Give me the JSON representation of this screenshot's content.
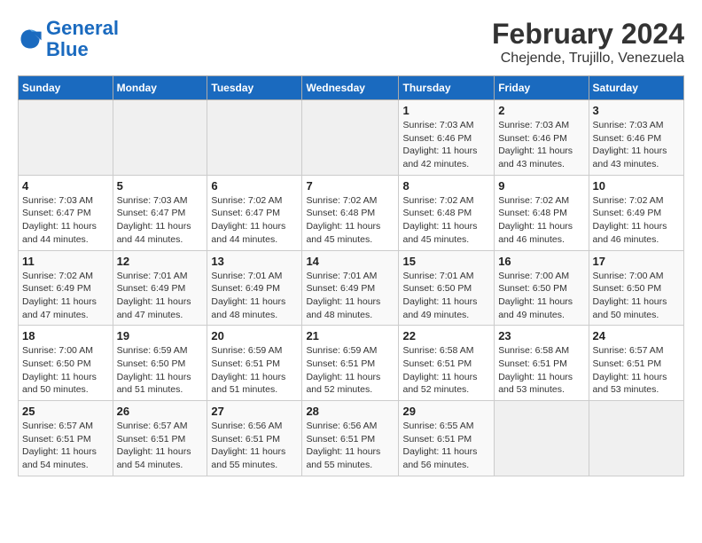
{
  "logo": {
    "general": "General",
    "blue": "Blue"
  },
  "title": "February 2024",
  "subtitle": "Chejende, Trujillo, Venezuela",
  "weekdays": [
    "Sunday",
    "Monday",
    "Tuesday",
    "Wednesday",
    "Thursday",
    "Friday",
    "Saturday"
  ],
  "weeks": [
    [
      {
        "day": "",
        "sunrise": "",
        "sunset": "",
        "daylight": ""
      },
      {
        "day": "",
        "sunrise": "",
        "sunset": "",
        "daylight": ""
      },
      {
        "day": "",
        "sunrise": "",
        "sunset": "",
        "daylight": ""
      },
      {
        "day": "",
        "sunrise": "",
        "sunset": "",
        "daylight": ""
      },
      {
        "day": "1",
        "sunrise": "Sunrise: 7:03 AM",
        "sunset": "Sunset: 6:46 PM",
        "daylight": "Daylight: 11 hours and 42 minutes."
      },
      {
        "day": "2",
        "sunrise": "Sunrise: 7:03 AM",
        "sunset": "Sunset: 6:46 PM",
        "daylight": "Daylight: 11 hours and 43 minutes."
      },
      {
        "day": "3",
        "sunrise": "Sunrise: 7:03 AM",
        "sunset": "Sunset: 6:46 PM",
        "daylight": "Daylight: 11 hours and 43 minutes."
      }
    ],
    [
      {
        "day": "4",
        "sunrise": "Sunrise: 7:03 AM",
        "sunset": "Sunset: 6:47 PM",
        "daylight": "Daylight: 11 hours and 44 minutes."
      },
      {
        "day": "5",
        "sunrise": "Sunrise: 7:03 AM",
        "sunset": "Sunset: 6:47 PM",
        "daylight": "Daylight: 11 hours and 44 minutes."
      },
      {
        "day": "6",
        "sunrise": "Sunrise: 7:02 AM",
        "sunset": "Sunset: 6:47 PM",
        "daylight": "Daylight: 11 hours and 44 minutes."
      },
      {
        "day": "7",
        "sunrise": "Sunrise: 7:02 AM",
        "sunset": "Sunset: 6:48 PM",
        "daylight": "Daylight: 11 hours and 45 minutes."
      },
      {
        "day": "8",
        "sunrise": "Sunrise: 7:02 AM",
        "sunset": "Sunset: 6:48 PM",
        "daylight": "Daylight: 11 hours and 45 minutes."
      },
      {
        "day": "9",
        "sunrise": "Sunrise: 7:02 AM",
        "sunset": "Sunset: 6:48 PM",
        "daylight": "Daylight: 11 hours and 46 minutes."
      },
      {
        "day": "10",
        "sunrise": "Sunrise: 7:02 AM",
        "sunset": "Sunset: 6:49 PM",
        "daylight": "Daylight: 11 hours and 46 minutes."
      }
    ],
    [
      {
        "day": "11",
        "sunrise": "Sunrise: 7:02 AM",
        "sunset": "Sunset: 6:49 PM",
        "daylight": "Daylight: 11 hours and 47 minutes."
      },
      {
        "day": "12",
        "sunrise": "Sunrise: 7:01 AM",
        "sunset": "Sunset: 6:49 PM",
        "daylight": "Daylight: 11 hours and 47 minutes."
      },
      {
        "day": "13",
        "sunrise": "Sunrise: 7:01 AM",
        "sunset": "Sunset: 6:49 PM",
        "daylight": "Daylight: 11 hours and 48 minutes."
      },
      {
        "day": "14",
        "sunrise": "Sunrise: 7:01 AM",
        "sunset": "Sunset: 6:49 PM",
        "daylight": "Daylight: 11 hours and 48 minutes."
      },
      {
        "day": "15",
        "sunrise": "Sunrise: 7:01 AM",
        "sunset": "Sunset: 6:50 PM",
        "daylight": "Daylight: 11 hours and 49 minutes."
      },
      {
        "day": "16",
        "sunrise": "Sunrise: 7:00 AM",
        "sunset": "Sunset: 6:50 PM",
        "daylight": "Daylight: 11 hours and 49 minutes."
      },
      {
        "day": "17",
        "sunrise": "Sunrise: 7:00 AM",
        "sunset": "Sunset: 6:50 PM",
        "daylight": "Daylight: 11 hours and 50 minutes."
      }
    ],
    [
      {
        "day": "18",
        "sunrise": "Sunrise: 7:00 AM",
        "sunset": "Sunset: 6:50 PM",
        "daylight": "Daylight: 11 hours and 50 minutes."
      },
      {
        "day": "19",
        "sunrise": "Sunrise: 6:59 AM",
        "sunset": "Sunset: 6:50 PM",
        "daylight": "Daylight: 11 hours and 51 minutes."
      },
      {
        "day": "20",
        "sunrise": "Sunrise: 6:59 AM",
        "sunset": "Sunset: 6:51 PM",
        "daylight": "Daylight: 11 hours and 51 minutes."
      },
      {
        "day": "21",
        "sunrise": "Sunrise: 6:59 AM",
        "sunset": "Sunset: 6:51 PM",
        "daylight": "Daylight: 11 hours and 52 minutes."
      },
      {
        "day": "22",
        "sunrise": "Sunrise: 6:58 AM",
        "sunset": "Sunset: 6:51 PM",
        "daylight": "Daylight: 11 hours and 52 minutes."
      },
      {
        "day": "23",
        "sunrise": "Sunrise: 6:58 AM",
        "sunset": "Sunset: 6:51 PM",
        "daylight": "Daylight: 11 hours and 53 minutes."
      },
      {
        "day": "24",
        "sunrise": "Sunrise: 6:57 AM",
        "sunset": "Sunset: 6:51 PM",
        "daylight": "Daylight: 11 hours and 53 minutes."
      }
    ],
    [
      {
        "day": "25",
        "sunrise": "Sunrise: 6:57 AM",
        "sunset": "Sunset: 6:51 PM",
        "daylight": "Daylight: 11 hours and 54 minutes."
      },
      {
        "day": "26",
        "sunrise": "Sunrise: 6:57 AM",
        "sunset": "Sunset: 6:51 PM",
        "daylight": "Daylight: 11 hours and 54 minutes."
      },
      {
        "day": "27",
        "sunrise": "Sunrise: 6:56 AM",
        "sunset": "Sunset: 6:51 PM",
        "daylight": "Daylight: 11 hours and 55 minutes."
      },
      {
        "day": "28",
        "sunrise": "Sunrise: 6:56 AM",
        "sunset": "Sunset: 6:51 PM",
        "daylight": "Daylight: 11 hours and 55 minutes."
      },
      {
        "day": "29",
        "sunrise": "Sunrise: 6:55 AM",
        "sunset": "Sunset: 6:51 PM",
        "daylight": "Daylight: 11 hours and 56 minutes."
      },
      {
        "day": "",
        "sunrise": "",
        "sunset": "",
        "daylight": ""
      },
      {
        "day": "",
        "sunrise": "",
        "sunset": "",
        "daylight": ""
      }
    ]
  ]
}
